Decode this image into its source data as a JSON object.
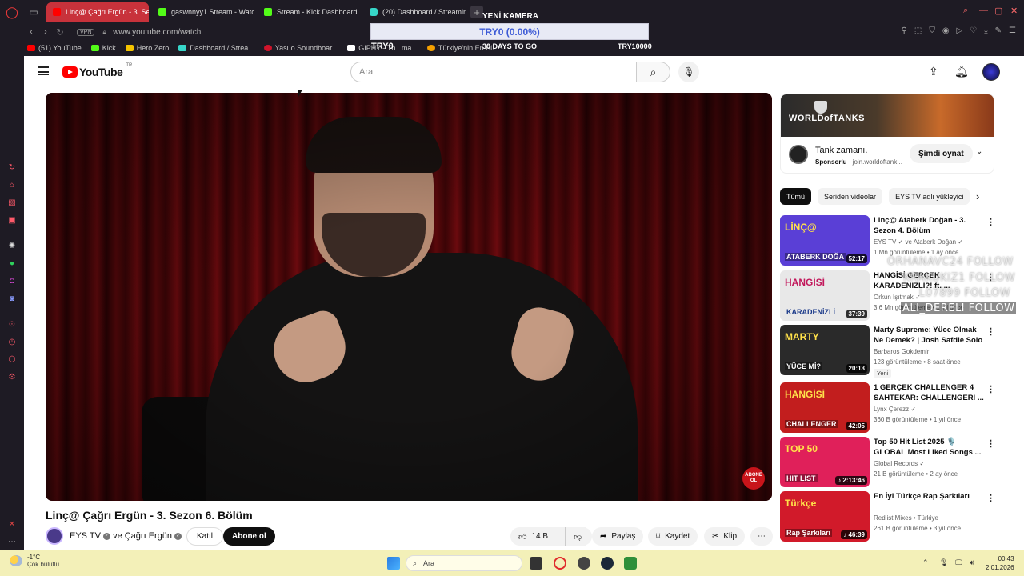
{
  "browser": {
    "tabs": [
      {
        "label": "Linç@ Çağrı Ergün - 3. Se",
        "favicon": "youtube-icon",
        "active": true
      },
      {
        "label": "gaswnnyy1 Stream - Watc",
        "favicon": "kick-icon",
        "active": false
      },
      {
        "label": "Stream - Kick Dashboard",
        "favicon": "kick-icon",
        "active": false
      },
      {
        "label": "(20) Dashboard / Streamin",
        "favicon": "streamlabs-icon",
        "active": false
      }
    ],
    "new_tab": "+",
    "vpn_label": "VPN",
    "url": "www.youtube.com/watch",
    "bookmarks": [
      {
        "label": "(51) YouTube",
        "color": "#ff0000"
      },
      {
        "label": "Kick",
        "color": "#53fc18"
      },
      {
        "label": "Hero Zero",
        "color": "#f5c400"
      },
      {
        "label": "Dashboard / Strea...",
        "color": "#37d6c9"
      },
      {
        "label": "Yasuo Soundboar...",
        "color": "#d0142b"
      },
      {
        "label": "GIPHY - Th...ma...",
        "color": "#ffffff"
      },
      {
        "label": "Türkiye'nin En Bü...",
        "color": "#f5a000"
      }
    ]
  },
  "stream_overlay": {
    "title": "YENİ KAMERA",
    "goal_text": "TRY0 (0.00%)",
    "goal_progress": 0,
    "left_label": "TRY0",
    "days_label": "30 DAYS TO GO",
    "target_label": "TRY10000"
  },
  "youtube": {
    "logo_text": "YouTube",
    "country_code": "TR",
    "search_placeholder": "Ara",
    "video": {
      "title": "Linç@ Çağrı Ergün - 3. Sezon 6. Bölüm",
      "watermark_label": "ABONE OL",
      "channel": "EYS TV",
      "collab": "ve Çağrı Ergün",
      "join_label": "Katıl",
      "subscribe_label": "Abone ol",
      "likes": "14 B",
      "share_label": "Paylaş",
      "save_label": "Kaydet",
      "clip_label": "Klip",
      "more_label": "⋯"
    },
    "ad": {
      "brand_text": "WORLDofTANKS",
      "title": "Tank zamanı.",
      "sponsor_label": "Sponsorlu",
      "sponsor_domain": "join.worldoftank...",
      "cta": "Şimdi oynat"
    },
    "chips": [
      "Tümü",
      "Seriden videolar",
      "EYS TV adlı yükleyici"
    ],
    "recommendations": [
      {
        "title": "Linç@ Ataberk Doğan - 3. Sezon 4. Bölüm",
        "channel": "EYS TV ✓ ve Ataberk Doğan ✓",
        "meta": "1 Mn görüntüleme • 1 ay önce",
        "duration": "52:17",
        "thumb_text": "LİNÇ@",
        "thumb_sub": "ATABERK DOĞA",
        "thumb_color": "#5a3fd6",
        "badge": ""
      },
      {
        "title": "HANGİSİ GERÇEK KARADENİZLİ?! ft. ...",
        "channel": "Orkun Işıtmak ✓",
        "meta": "3,6 Mn görüntüleme • 1 yıl önce",
        "duration": "37:39",
        "thumb_text": "HANGİSİ",
        "thumb_sub": "KARADENİZLİ",
        "thumb_color": "#e8e8e8",
        "badge": ""
      },
      {
        "title": "Marty Supreme: Yüce Olmak Ne Demek? | Josh Safdie Solo ...",
        "channel": "Barbaros Gokdemir",
        "meta": "123 görüntüleme • 8 saat önce",
        "duration": "20:13",
        "thumb_text": "MARTY",
        "thumb_sub": "YÜCE Mİ?",
        "thumb_color": "#2a2a2a",
        "badge": "Yeni"
      },
      {
        "title": "1 GERÇEK CHALLENGER 4 SAHTEKAR: CHALLENGERI ...",
        "channel": "Lynx Çerezz ✓",
        "meta": "360 B görüntüleme • 1 yıl önce",
        "duration": "42:05",
        "thumb_text": "HANGİSİ",
        "thumb_sub": "CHALLENGER",
        "thumb_color": "#c21e1e",
        "badge": ""
      },
      {
        "title": "Top 50 Hit List 2025 🎙️ GLOBAL Most Liked Songs ...",
        "channel": "Global Records ✓",
        "meta": "21 B görüntüleme • 2 ay önce",
        "duration": "♪ 2:13:46",
        "thumb_text": "TOP 50",
        "thumb_sub": "HIT LIST",
        "thumb_color": "#e0205a",
        "badge": ""
      },
      {
        "title": "En İyi Türkçe Rap Şarkıları",
        "channel": "Redlist Mixes • Türkiye",
        "meta": "261 B görüntüleme • 3 yıl önce",
        "duration": "♪ 46:39",
        "thumb_text": "Türkçe",
        "thumb_sub": "Rap Şarkıları",
        "thumb_color": "#d11a2a",
        "badge": ""
      }
    ]
  },
  "follow_overlay": [
    {
      "text": "ORHANAVC24 FOLLOW",
      "style": "faded"
    },
    {
      "text": "KRAKUKIZ1 FOLLOW",
      "style": "faded"
    },
    {
      "text": "L07899 FOLLOW",
      "style": "faded"
    },
    {
      "text": "ALI_DERELI FOLLOW",
      "style": "strong"
    }
  ],
  "taskbar": {
    "temperature": "-1°C",
    "weather": "Çok bulutlu",
    "search_placeholder": "Ara",
    "time": "00:43",
    "date": "2.01.2026"
  }
}
